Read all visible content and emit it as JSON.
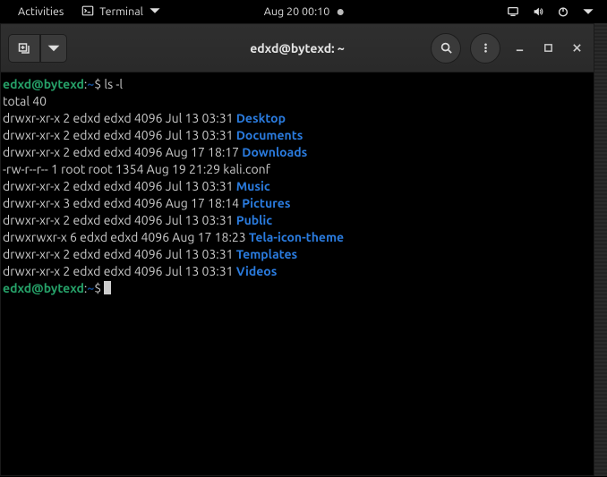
{
  "top_panel": {
    "activities": "Activities",
    "app_name": "Terminal",
    "datetime": "Aug 20  00:10"
  },
  "window": {
    "title": "edxd@bytexd: ~"
  },
  "prompt": {
    "user": "edxd",
    "at": "@",
    "host": "bytexd",
    "colon": ":",
    "path": "~",
    "dollar": "$"
  },
  "command": "ls -l",
  "total_line": "total 40",
  "listing": [
    {
      "meta": "drwxr-xr-x 2 edxd edxd 4096 Jul 13 03:31 ",
      "name": "Desktop",
      "dir": true
    },
    {
      "meta": "drwxr-xr-x 2 edxd edxd 4096 Jul 13 03:31 ",
      "name": "Documents",
      "dir": true
    },
    {
      "meta": "drwxr-xr-x 2 edxd edxd 4096 Aug 17 18:17 ",
      "name": "Downloads",
      "dir": true
    },
    {
      "meta": "-rw-r--r-- 1 root root 1354 Aug 19 21:29 ",
      "name": "kali.conf",
      "dir": false
    },
    {
      "meta": "drwxr-xr-x 2 edxd edxd 4096 Jul 13 03:31 ",
      "name": "Music",
      "dir": true
    },
    {
      "meta": "drwxr-xr-x 3 edxd edxd 4096 Aug 17 18:14 ",
      "name": "Pictures",
      "dir": true
    },
    {
      "meta": "drwxr-xr-x 2 edxd edxd 4096 Jul 13 03:31 ",
      "name": "Public",
      "dir": true
    },
    {
      "meta": "drwxrwxr-x 6 edxd edxd 4096 Aug 17 18:23 ",
      "name": "Tela-icon-theme",
      "dir": true
    },
    {
      "meta": "drwxr-xr-x 2 edxd edxd 4096 Jul 13 03:31 ",
      "name": "Templates",
      "dir": true
    },
    {
      "meta": "drwxr-xr-x 2 edxd edxd 4096 Jul 13 03:31 ",
      "name": "Videos",
      "dir": true
    }
  ]
}
